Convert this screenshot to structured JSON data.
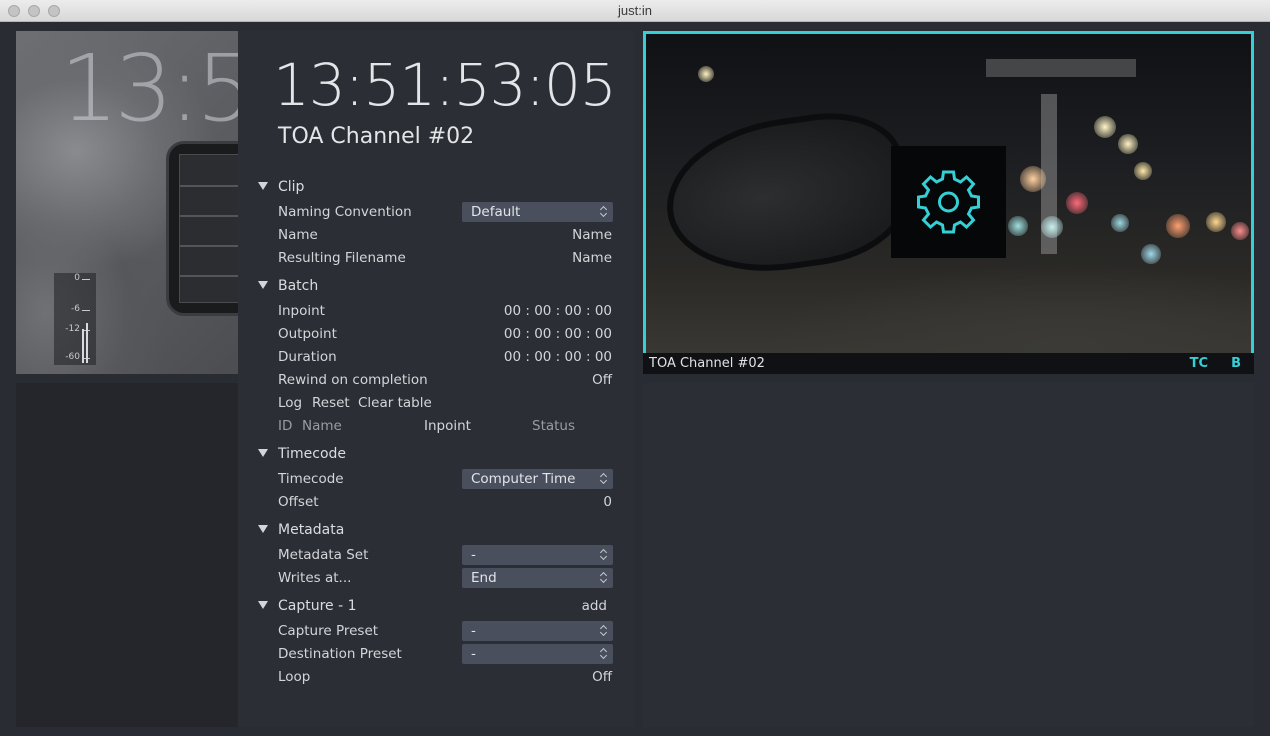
{
  "window": {
    "title": "just:in"
  },
  "left_preview": {
    "timecode_fragment": "13:5",
    "meter_labels": [
      "0",
      "-6",
      "-12",
      "-60"
    ]
  },
  "middle": {
    "timecode": "13:51:53:05",
    "channel_title": "TOA Channel #02",
    "clip": {
      "header": "Clip",
      "naming_convention_label": "Naming Convention",
      "naming_convention_value": "Default",
      "name_label": "Name",
      "name_value": "Name",
      "resulting_filename_label": "Resulting Filename",
      "resulting_filename_value": "Name"
    },
    "batch": {
      "header": "Batch",
      "inpoint_label": "Inpoint",
      "inpoint_value": "00 : 00 : 00 : 00",
      "outpoint_label": "Outpoint",
      "outpoint_value": "00 : 00 : 00 : 00",
      "duration_label": "Duration",
      "duration_value": "00 : 00 : 00 : 00",
      "rewind_label": "Rewind on completion",
      "rewind_value": "Off",
      "actions": {
        "log": "Log",
        "reset": "Reset",
        "clear_table": "Clear table"
      },
      "table_columns": {
        "id": "ID",
        "name": "Name",
        "inpoint": "Inpoint",
        "status": "Status"
      }
    },
    "timecode_section": {
      "header": "Timecode",
      "timecode_label": "Timecode",
      "timecode_value": "Computer Time",
      "offset_label": "Offset",
      "offset_value": "0"
    },
    "metadata": {
      "header": "Metadata",
      "set_label": "Metadata Set",
      "set_value": "-",
      "writes_label": "Writes at...",
      "writes_value": "End"
    },
    "capture": {
      "header": "Capture - 1",
      "add_label": "add",
      "capture_preset_label": "Capture Preset",
      "capture_preset_value": "-",
      "destination_preset_label": "Destination Preset",
      "destination_preset_value": "-",
      "loop_label": "Loop",
      "loop_value": "Off"
    }
  },
  "right_preview": {
    "channel_name": "TOA Channel #02",
    "tc_badge": "TC",
    "b_badge": "B",
    "accent_color": "#35cfd6",
    "center_icon": "gear-icon"
  }
}
